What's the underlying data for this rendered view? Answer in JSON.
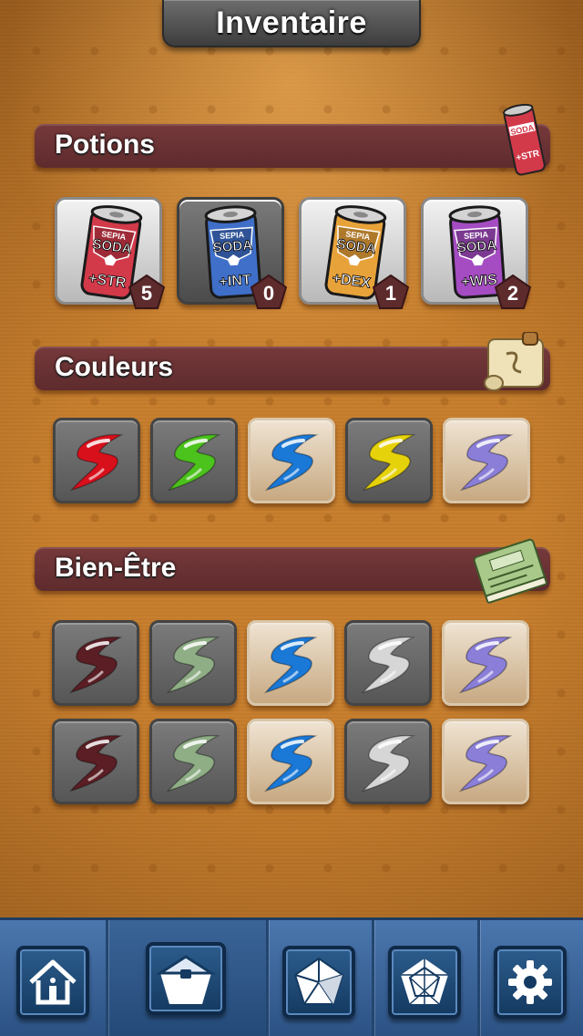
{
  "header": {
    "title": "Inventaire"
  },
  "sections": {
    "potions": {
      "label": "Potions",
      "items": [
        {
          "brand": "SEPIA",
          "name": "SODA",
          "stat": "+STR",
          "count": "5",
          "color": "#d23a4a"
        },
        {
          "brand": "SEPIA",
          "name": "SODA",
          "stat": "+INT",
          "count": "0",
          "color": "#3f6fc8"
        },
        {
          "brand": "SEPIA",
          "name": "SODA",
          "stat": "+DEX",
          "count": "1",
          "color": "#e8a23a"
        },
        {
          "brand": "SEPIA",
          "name": "SODA",
          "stat": "+WIS",
          "count": "2",
          "color": "#a54cc2"
        }
      ]
    },
    "couleurs": {
      "label": "Couleurs",
      "colors": [
        "#d8101c",
        "#4cc21c",
        "#1a78d6",
        "#e6d20a",
        "#8a7ed8"
      ]
    },
    "bien_etre": {
      "label": "Bien-Être",
      "rows": [
        [
          "#5a1e24",
          "#8fae86",
          "#1a78d6",
          "#d6d6d6",
          "#8a7ed8"
        ],
        [
          "#5a1e24",
          "#8fae86",
          "#1a78d6",
          "#d6d6d6",
          "#8a7ed8"
        ]
      ]
    }
  },
  "nav": {
    "items": [
      "home-icon",
      "pentagon-inventory-icon",
      "pentagon-sections-icon",
      "pentagon-web-icon",
      "gear-icon"
    ],
    "active": "pentagon-inventory-icon"
  }
}
